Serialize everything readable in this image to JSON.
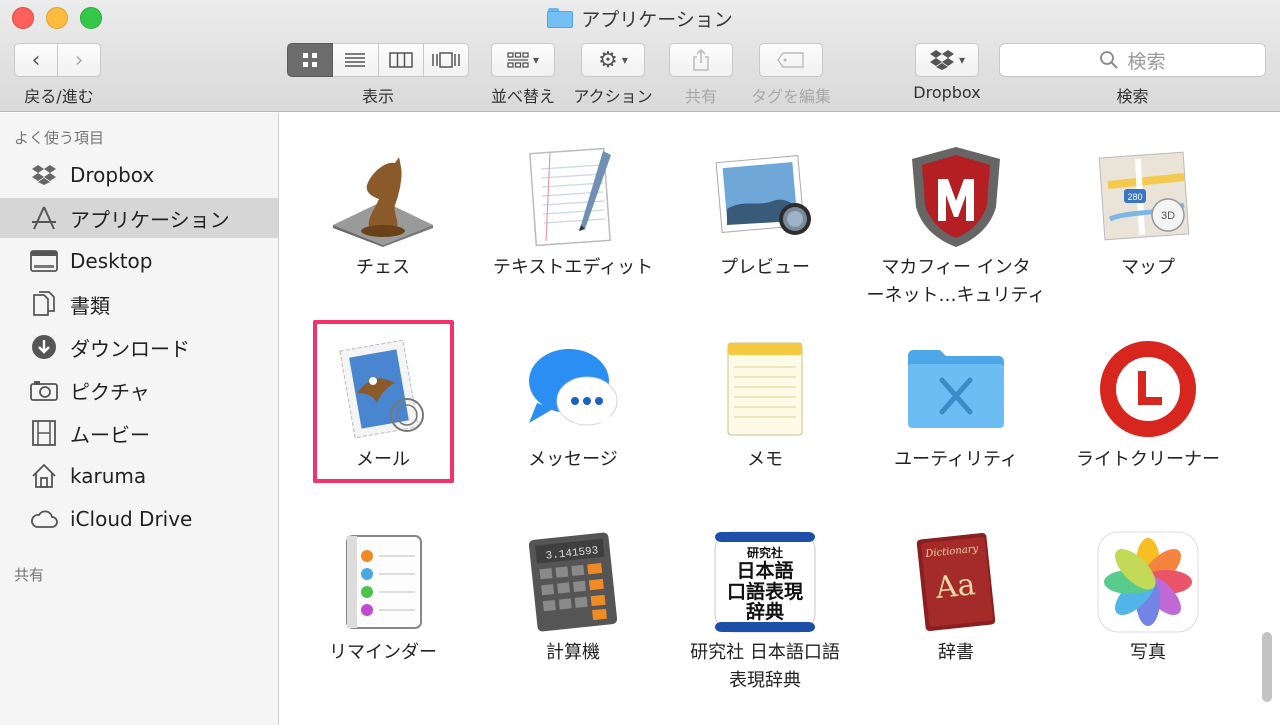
{
  "window": {
    "title": "アプリケーション"
  },
  "toolbar": {
    "back_forward_label": "戻る/進む",
    "view_label": "表示",
    "arrange_label": "並べ替え",
    "action_label": "アクション",
    "share_label": "共有",
    "tags_label": "タグを編集",
    "dropbox_label": "Dropbox",
    "search_label": "検索",
    "search_placeholder": "検索"
  },
  "sidebar": {
    "favorites_heading": "よく使う項目",
    "shared_heading": "共有",
    "items": [
      {
        "label": "Dropbox",
        "icon": "dropbox-icon"
      },
      {
        "label": "アプリケーション",
        "icon": "applications-icon",
        "selected": true
      },
      {
        "label": "Desktop",
        "icon": "desktop-icon"
      },
      {
        "label": "書類",
        "icon": "documents-icon"
      },
      {
        "label": "ダウンロード",
        "icon": "downloads-icon"
      },
      {
        "label": "ピクチャ",
        "icon": "camera-icon"
      },
      {
        "label": "ムービー",
        "icon": "film-icon"
      },
      {
        "label": "karuma",
        "icon": "home-icon"
      },
      {
        "label": "iCloud Drive",
        "icon": "cloud-icon"
      }
    ]
  },
  "apps": [
    {
      "label": "チェス"
    },
    {
      "label": "テキストエディット"
    },
    {
      "label": "プレビュー"
    },
    {
      "label": "マカフィー インタ\nーネット…キュリティ"
    },
    {
      "label": "マップ"
    },
    {
      "label": "メール",
      "highlighted": true
    },
    {
      "label": "メッセージ"
    },
    {
      "label": "メモ"
    },
    {
      "label": "ユーティリティ"
    },
    {
      "label": "ライトクリーナー"
    },
    {
      "label": "リマインダー"
    },
    {
      "label": "計算機"
    },
    {
      "label": "研究社 日本語口語\n表現辞典"
    },
    {
      "label": "辞書"
    },
    {
      "label": "写真"
    }
  ],
  "icon_text": {
    "calculator_display": "3.141593",
    "kenkyusha_line1": "研究社",
    "kenkyusha_line2": "日本語",
    "kenkyusha_line3": "口語表現",
    "kenkyusha_line4": "辞典",
    "dictionary_title": "Dictionary",
    "dictionary_letters": "Aa",
    "maps_route": "280",
    "maps_3d": "3D"
  },
  "colors": {
    "highlight_border": "#f0336b",
    "sidebar_selected": "#d6d6d6"
  }
}
